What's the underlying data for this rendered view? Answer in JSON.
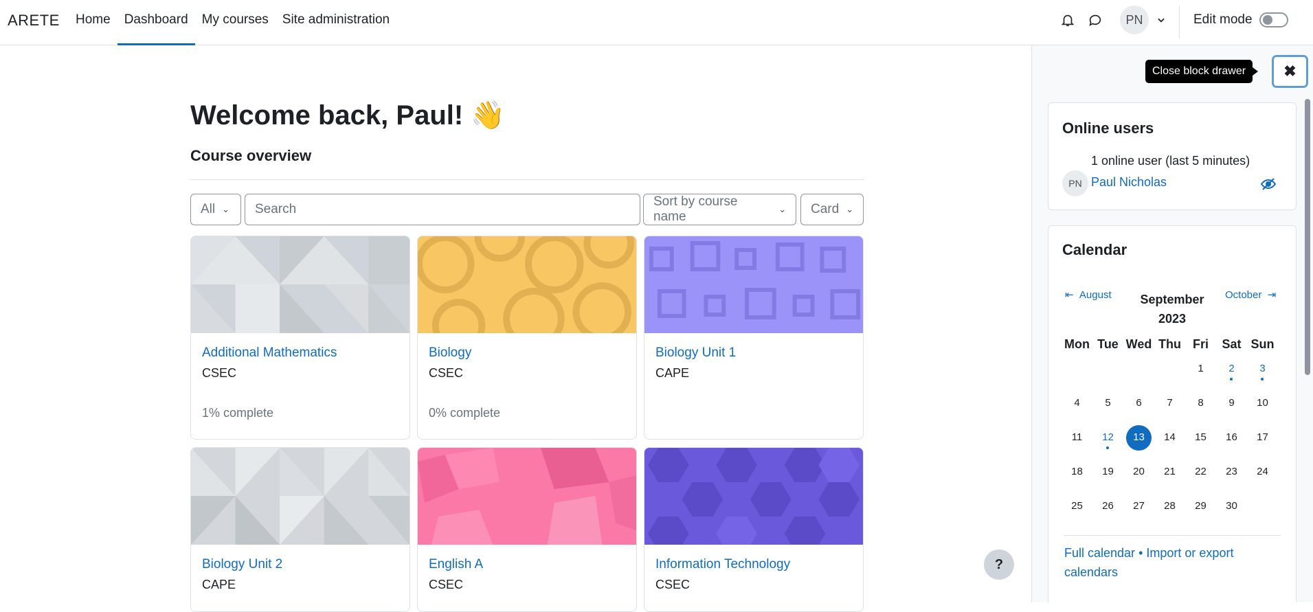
{
  "nav": {
    "brand": "ARETE",
    "items": [
      {
        "label": "Home"
      },
      {
        "label": "Dashboard"
      },
      {
        "label": "My courses"
      },
      {
        "label": "Site administration"
      }
    ],
    "avatar_initials": "PN",
    "edit_mode_label": "Edit mode"
  },
  "main": {
    "welcome": "Welcome back, Paul! 👋",
    "section_title": "Course overview",
    "filter": {
      "label": "All"
    },
    "search": {
      "placeholder": "Search"
    },
    "sort": {
      "label": "Sort by course name"
    },
    "view": {
      "label": "Card"
    },
    "courses": [
      {
        "name": "Additional Mathematics",
        "category": "CSEC",
        "progress": "1% complete",
        "color": "#ced4da"
      },
      {
        "name": "Biology",
        "category": "CSEC",
        "progress": "0% complete",
        "color": "#f8c663"
      },
      {
        "name": "Biology Unit 1",
        "category": "CAPE",
        "progress": "",
        "color": "#9b93f7"
      },
      {
        "name": "Biology Unit 2",
        "category": "CAPE",
        "progress": "",
        "color": "#ced4da"
      },
      {
        "name": "English A",
        "category": "CSEC",
        "progress": "",
        "color": "#fb79a6"
      },
      {
        "name": "Information Technology",
        "category": "CSEC",
        "progress": "",
        "color": "#6a5adb"
      }
    ],
    "help_label": "?"
  },
  "drawer": {
    "tooltip": "Close block drawer",
    "close_label": "✖",
    "online_users": {
      "title": "Online users",
      "count_text": "1 online user (last 5 minutes)",
      "user_initials": "PN",
      "user_name": "Paul Nicholas"
    },
    "calendar": {
      "title": "Calendar",
      "prev_label": "August",
      "next_label": "October",
      "month_line1": "September",
      "month_line2": "2023",
      "weekdays": [
        "Mon",
        "Tue",
        "Wed",
        "Thu",
        "Fri",
        "Sat",
        "Sun"
      ],
      "weeks": [
        [
          "",
          "",
          "",
          "",
          "1",
          "2",
          "3"
        ],
        [
          "4",
          "5",
          "6",
          "7",
          "8",
          "9",
          "10"
        ],
        [
          "11",
          "12",
          "13",
          "14",
          "15",
          "16",
          "17"
        ],
        [
          "18",
          "19",
          "20",
          "21",
          "22",
          "23",
          "24"
        ],
        [
          "25",
          "26",
          "27",
          "28",
          "29",
          "30",
          ""
        ]
      ],
      "event_days": [
        "2",
        "3",
        "12"
      ],
      "today": "13",
      "full_calendar": "Full calendar",
      "separator": "•",
      "import_export": "Import or export calendars"
    }
  },
  "colors": {
    "accent": "#0f6cbf",
    "text": "#1d2125",
    "muted": "#6a737b"
  }
}
